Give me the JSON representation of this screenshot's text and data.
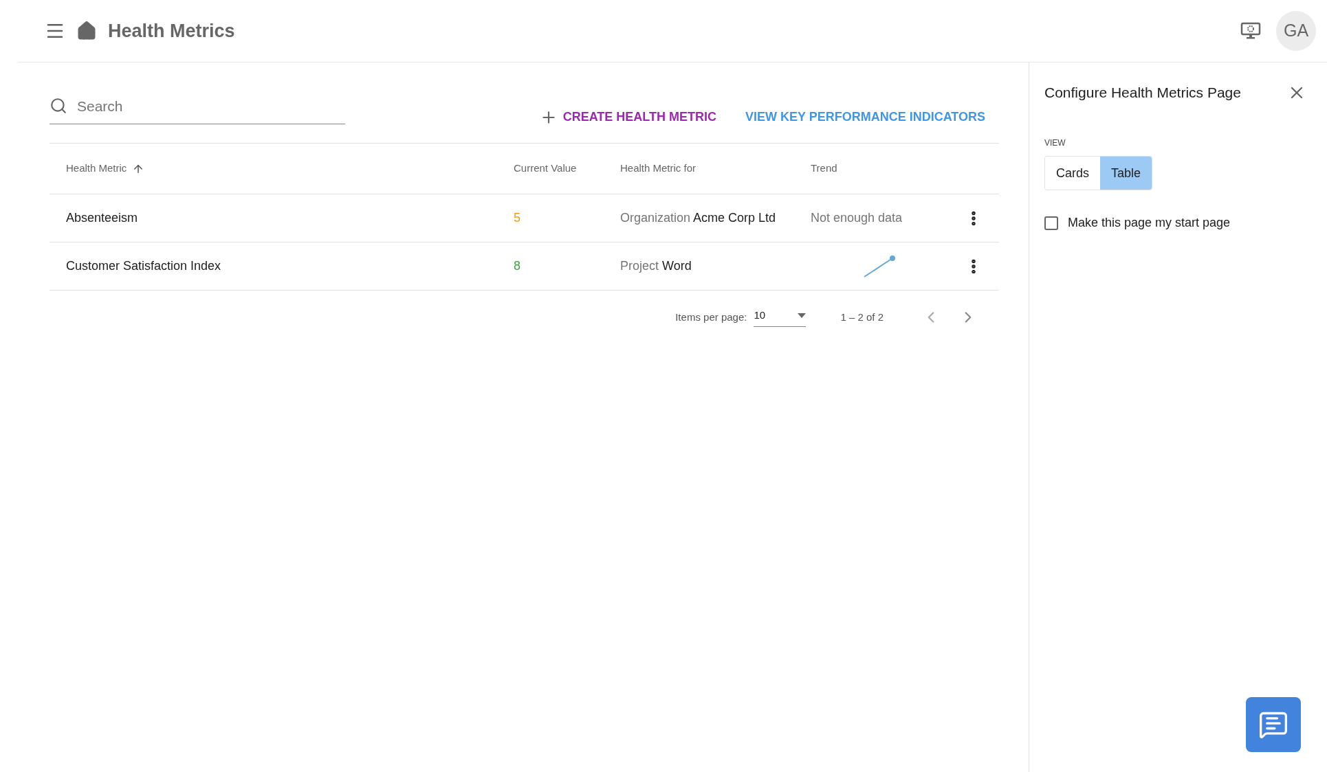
{
  "app_bar": {
    "title": "Health Metrics",
    "avatar": "GA"
  },
  "search": {
    "placeholder": "Search"
  },
  "actions": [
    {
      "label": "CREATE HEALTH METRIC",
      "kind": "create"
    },
    {
      "label": "VIEW KEY PERFORMANCE INDICATORS",
      "kind": "link"
    }
  ],
  "table": {
    "columns": [
      {
        "label": "Health Metric",
        "sorted": true
      },
      {
        "label": "Current Value",
        "sorted": false
      },
      {
        "label": "Health Metric for",
        "sorted": false
      },
      {
        "label": "Trend",
        "sorted": false
      }
    ],
    "rows": [
      {
        "name": "Absenteeism",
        "value": "5",
        "color": "#f39c12",
        "for_type": "Organization",
        "for_name": "Acme Corp Ltd",
        "trend": {
          "kind": "text",
          "text": "Not enough data"
        }
      },
      {
        "name": "Customer Satisfaction Index",
        "value": "8",
        "color": "#43a047",
        "for_type": "Project",
        "for_name": "Word",
        "trend": {
          "kind": "sparkline"
        }
      }
    ]
  },
  "pagination": {
    "label": "Items per page:",
    "page_size": "10",
    "range": "1 – 2 of 2"
  },
  "panel": {
    "title": "Configure Health Metrics Page",
    "view_label": "VIEW",
    "views": [
      {
        "label": "Cards",
        "selected": false
      },
      {
        "label": "Table",
        "selected": true
      }
    ],
    "start_page": {
      "label": "Make this page my start page",
      "checked": false
    }
  }
}
